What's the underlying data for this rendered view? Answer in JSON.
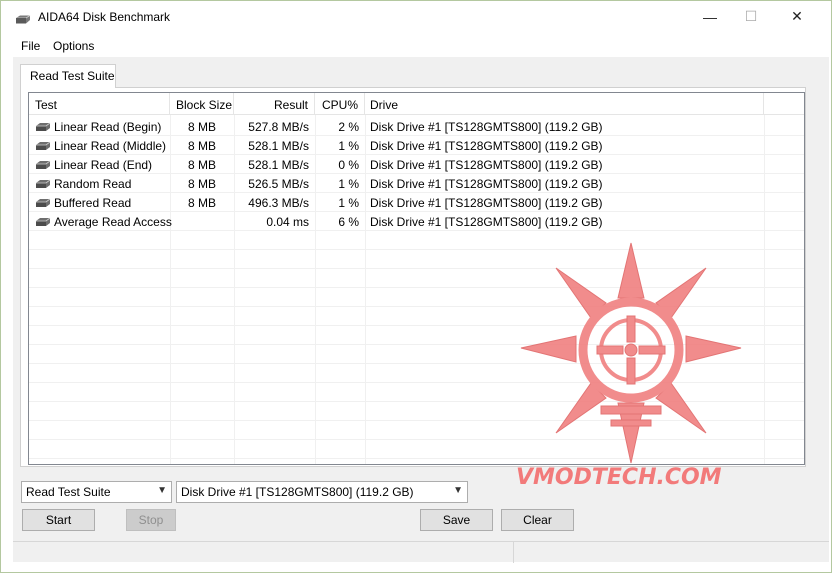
{
  "window": {
    "title": "AIDA64 Disk Benchmark",
    "minimize_glyph": "—",
    "maximize_glyph": "☐",
    "close_glyph": "✕"
  },
  "menu": {
    "file": "File",
    "options": "Options"
  },
  "tab": {
    "label": "Read Test Suite"
  },
  "table": {
    "columns": {
      "test": "Test",
      "block_size": "Block Size",
      "result": "Result",
      "cpu": "CPU%",
      "drive": "Drive"
    },
    "rows": [
      {
        "test": "Linear Read (Begin)",
        "block_size": "8 MB",
        "result": "527.8 MB/s",
        "cpu": "2 %",
        "drive": "Disk Drive #1  [TS128GMTS800]  (119.2 GB)"
      },
      {
        "test": "Linear Read (Middle)",
        "block_size": "8 MB",
        "result": "528.1 MB/s",
        "cpu": "1 %",
        "drive": "Disk Drive #1  [TS128GMTS800]  (119.2 GB)"
      },
      {
        "test": "Linear Read (End)",
        "block_size": "8 MB",
        "result": "528.1 MB/s",
        "cpu": "0 %",
        "drive": "Disk Drive #1  [TS128GMTS800]  (119.2 GB)"
      },
      {
        "test": "Random Read",
        "block_size": "8 MB",
        "result": "526.5 MB/s",
        "cpu": "1 %",
        "drive": "Disk Drive #1  [TS128GMTS800]  (119.2 GB)"
      },
      {
        "test": "Buffered Read",
        "block_size": "8 MB",
        "result": "496.3 MB/s",
        "cpu": "1 %",
        "drive": "Disk Drive #1  [TS128GMTS800]  (119.2 GB)"
      },
      {
        "test": "Average Read Access",
        "block_size": "",
        "result": "0.04 ms",
        "cpu": "6 %",
        "drive": "Disk Drive #1  [TS128GMTS800]  (119.2 GB)"
      }
    ]
  },
  "controls": {
    "suite_select": "Read Test Suite",
    "drive_select": "Disk Drive #1  [TS128GMTS800]  (119.2 GB)",
    "start_label": "Start",
    "stop_label": "Stop",
    "save_label": "Save",
    "clear_label": "Clear"
  },
  "watermark": {
    "text": "VMODTECH.COM"
  },
  "colors": {
    "watermark": "#f27a7a"
  }
}
